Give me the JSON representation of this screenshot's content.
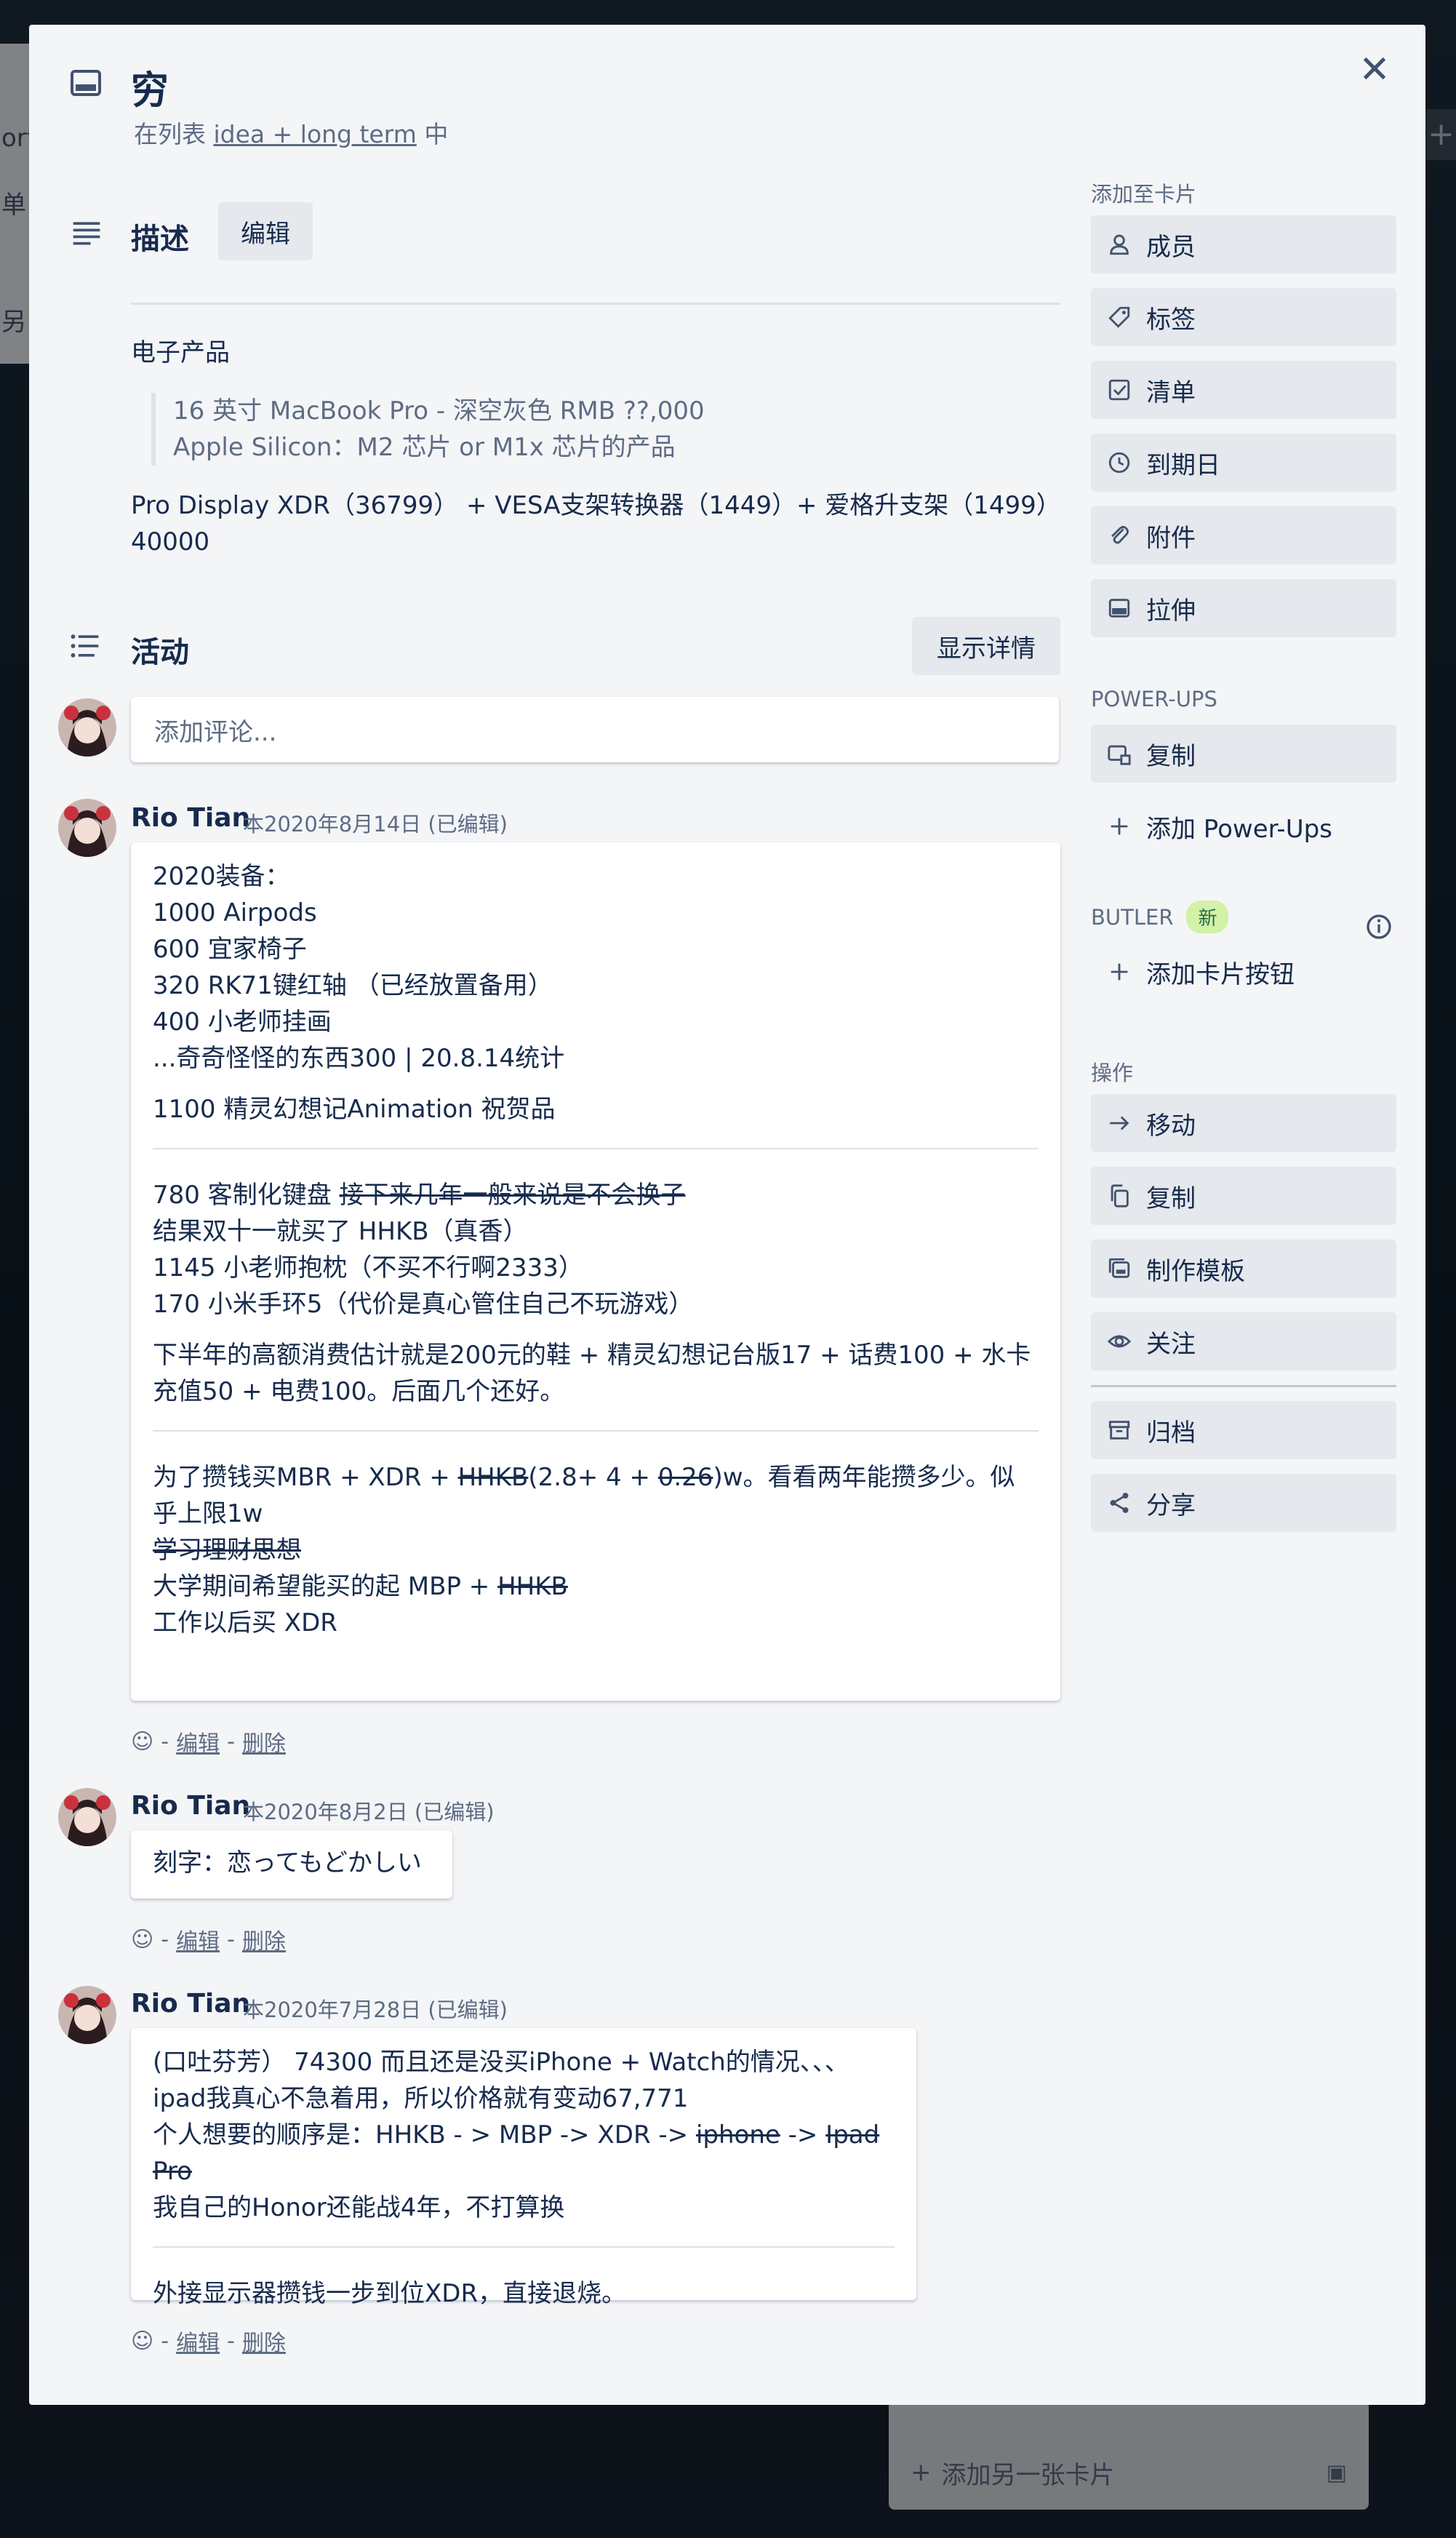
{
  "background": {
    "left_fragments": [
      "ort",
      "单",
      "另"
    ],
    "top_right_button": "+",
    "add_card_label": "添加另一张卡片"
  },
  "card": {
    "title": "穷",
    "in_list_prefix": "在列表",
    "list_name": "idea + long term",
    "in_list_suffix": "中",
    "close_icon": "close-icon"
  },
  "description": {
    "heading": "描述",
    "edit_label": "编辑",
    "category": "电子产品",
    "quote_lines": [
      "16 英寸 MacBook Pro - 深空灰色 RMB ??,000",
      "Apple Silicon：M2 芯片 or M1x 芯片的产品"
    ],
    "line1": "Pro Display XDR（36799） + VESA支架转换器（1449）+ 爱格升支架（1499）",
    "line2": "40000"
  },
  "activity": {
    "heading": "活动",
    "show_details_label": "显示详情",
    "comment_placeholder": "添加评论...",
    "edit_link": "编辑",
    "delete_link": "删除",
    "separator": "-",
    "comments": [
      {
        "author": "Rio Tian",
        "meta": "本2020年8月14日 (已编辑)",
        "b1": [
          "2020装备：",
          "1000 Airpods",
          "600 宜家椅子",
          "320 RK71键红轴 （已经放置备用）",
          "400 小老师挂画",
          "...奇奇怪怪的东西300 | 20.8.14统计"
        ],
        "b1_extra": "1100 精灵幻想记Animation 祝贺品",
        "b2_l1_plain": "780 客制化键盘 ",
        "b2_l1_strike": "接下来几年一般来说是不会换子",
        "b2_lines": [
          "结果双十一就买了 HHKB（真香）",
          "1145 小老师抱枕（不买不行啊2333）",
          "170 小米手环5（代价是真心管住自己不玩游戏）"
        ],
        "b2_para": "下半年的高额消费估计就是200元的鞋 + 精灵幻想记台版17 + 话费100 + 水卡充值50 + 电费100。后面几个还好。",
        "b3_l1_a": "为了攒钱买MBR + XDR + ",
        "b3_l1_s1": "HHKB",
        "b3_l1_b": "(2.8+ 4 + ",
        "b3_l1_s2": "0.26",
        "b3_l1_c": ")w。看看两年能攒多少。似乎上限1w",
        "b3_l2_strike": "学习理财思想",
        "b3_l3_a": "大学期间希望能买的起 MBP + ",
        "b3_l3_strike": "HHKB",
        "b3_l4": "工作以后买 XDR"
      },
      {
        "author": "Rio Tian",
        "meta": "本2020年8月2日 (已编辑)",
        "text": "刻字：恋ってもどかしい"
      },
      {
        "author": "Rio Tian",
        "meta": "本2020年7月28日 (已编辑)",
        "l1": "(口吐芬芳） 74300 而且还是没买iPhone + Watch的情况、、、",
        "l2": "ipad我真心不急着用，所以价格就有变动67,771",
        "l3_a": "个人想要的顺序是：HHKB - > MBP -> XDR -> ",
        "l3_s1": "iphone",
        "l3_b": " -> ",
        "l3_s2": "Ipad Pro",
        "l4": "我自己的Honor还能战4年，不打算换",
        "l5": "外接显示器攒钱一步到位XDR，直接退烧。"
      }
    ]
  },
  "sidebar": {
    "add_to_card_label": "添加至卡片",
    "add_items": [
      "成员",
      "标签",
      "清单",
      "到期日",
      "附件",
      "拉伸"
    ],
    "powerups_label": "POWER-UPS",
    "powerups_copy": "复制",
    "powerups_add": "添加 Power-Ups",
    "butler_label": "BUTLER",
    "butler_badge": "新",
    "butler_add": "添加卡片按钮",
    "actions_label": "操作",
    "actions": [
      "移动",
      "复制",
      "制作模板",
      "关注"
    ],
    "archive": "归档",
    "share": "分享"
  },
  "colors": {
    "modal_bg": "#f4f5f7",
    "button_bg": "#e5e8ec",
    "text": "#172b4d",
    "subtle": "#5e6c84",
    "badge_bg": "#d3f1a7"
  }
}
